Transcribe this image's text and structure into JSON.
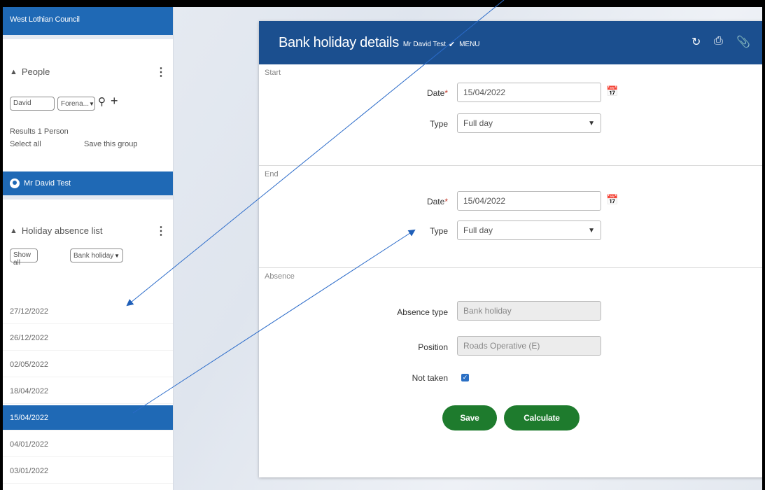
{
  "org": {
    "name": "West Lothian Council"
  },
  "people": {
    "heading": "People",
    "search_value": "David",
    "field_select": "Forena...",
    "results_text": "Results 1 Person",
    "select_all": "Select all",
    "save_group": "Save this group",
    "selected_person": "Mr David Test"
  },
  "absence_list": {
    "heading": "Holiday absence list",
    "show_all": "Show all",
    "filter_select": "Bank holiday",
    "items": [
      {
        "date": "27/12/2022",
        "active": false
      },
      {
        "date": "26/12/2022",
        "active": false
      },
      {
        "date": "02/05/2022",
        "active": false
      },
      {
        "date": "18/04/2022",
        "active": false
      },
      {
        "date": "15/04/2022",
        "active": true
      },
      {
        "date": "04/01/2022",
        "active": false
      },
      {
        "date": "03/01/2022",
        "active": false
      }
    ]
  },
  "header": {
    "title": "Bank holiday details",
    "subject": "Mr David Test",
    "menu_label": "MENU",
    "icons": [
      "refresh-icon",
      "print-icon",
      "attachment-icon"
    ]
  },
  "start": {
    "section_label": "Start",
    "date_label": "Date",
    "date_value": "15/04/2022",
    "type_label": "Type",
    "type_value": "Full day"
  },
  "end": {
    "section_label": "End",
    "date_label": "Date",
    "date_value": "15/04/2022",
    "type_label": "Type",
    "type_value": "Full day"
  },
  "absence": {
    "section_label": "Absence",
    "absence_type_label": "Absence type",
    "absence_type_value": "Bank holiday",
    "position_label": "Position",
    "position_value": "Roads Operative (E)",
    "not_taken_label": "Not taken",
    "not_taken_checked": true
  },
  "actions": {
    "save_label": "Save",
    "calculate_label": "Calculate"
  },
  "colors": {
    "primary": "#1f69b5",
    "header": "#1b4f8f",
    "button": "#1e7b2d",
    "required": "#c0392b"
  }
}
